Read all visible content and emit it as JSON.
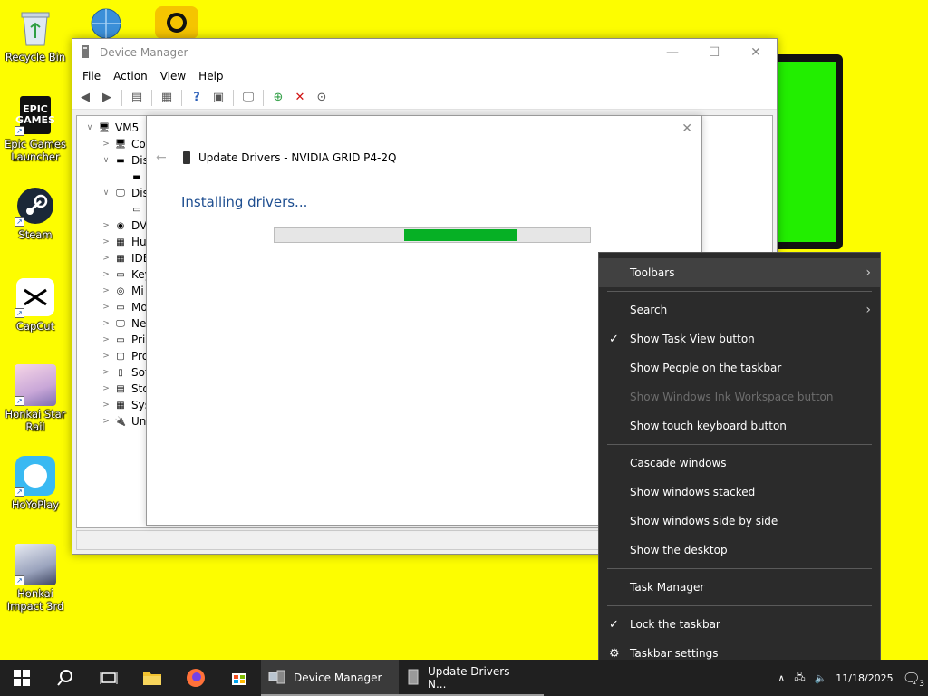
{
  "desktop": {
    "icons": [
      {
        "label": "Recycle Bin"
      },
      {
        "label": "Epic Games Launcher",
        "logo_text": "EPIC GAMES"
      },
      {
        "label": "Steam"
      },
      {
        "label": "CapCut"
      },
      {
        "label": "Honkai Star Rail"
      },
      {
        "label": "HoYoPlay"
      },
      {
        "label": "Honkai Impact 3rd"
      }
    ]
  },
  "device_manager": {
    "title": "Device Manager",
    "menu": [
      "File",
      "Action",
      "View",
      "Help"
    ],
    "tree": [
      {
        "label": "VM5",
        "arrow": "∨"
      },
      {
        "label": "Co",
        "arrow": ">"
      },
      {
        "label": "Dis",
        "arrow": "∨"
      },
      {
        "label": "",
        "arrow": ""
      },
      {
        "label": "Dis",
        "arrow": "∨"
      },
      {
        "label": "",
        "arrow": ""
      },
      {
        "label": "DV",
        "arrow": ">"
      },
      {
        "label": "Hu",
        "arrow": ">"
      },
      {
        "label": "IDE",
        "arrow": ">"
      },
      {
        "label": "Key",
        "arrow": ">"
      },
      {
        "label": "Mi",
        "arrow": ">"
      },
      {
        "label": "Mo",
        "arrow": ">"
      },
      {
        "label": "Ne",
        "arrow": ">"
      },
      {
        "label": "Pri",
        "arrow": ">"
      },
      {
        "label": "Pro",
        "arrow": ">"
      },
      {
        "label": "Sof",
        "arrow": ">"
      },
      {
        "label": "Sto",
        "arrow": ">"
      },
      {
        "label": "Sys",
        "arrow": ">"
      },
      {
        "label": "Un",
        "arrow": ">"
      }
    ]
  },
  "update_dialog": {
    "title": "Update Drivers - NVIDIA GRID P4-2Q",
    "status": "Installing drivers...",
    "progress": {
      "start": 0.41,
      "end": 0.77
    }
  },
  "context_menu": {
    "items": [
      {
        "label": "Toolbars",
        "submenu": true,
        "hover": true
      },
      {
        "sep": true
      },
      {
        "label": "Search",
        "submenu": true
      },
      {
        "label": "Show Task View button",
        "checked": true
      },
      {
        "label": "Show People on the taskbar"
      },
      {
        "label": "Show Windows Ink Workspace button",
        "disabled": true
      },
      {
        "label": "Show touch keyboard button"
      },
      {
        "sep": true
      },
      {
        "label": "Cascade windows"
      },
      {
        "label": "Show windows stacked"
      },
      {
        "label": "Show windows side by side"
      },
      {
        "label": "Show the desktop"
      },
      {
        "sep": true
      },
      {
        "label": "Task Manager"
      },
      {
        "sep": true
      },
      {
        "label": "Lock the taskbar",
        "checked": true
      },
      {
        "label": "Taskbar settings",
        "gear": true
      }
    ]
  },
  "taskbar": {
    "apps": [
      {
        "label": "Device Manager"
      },
      {
        "label": "Update Drivers - N..."
      }
    ],
    "date": "11/18/2025",
    "notification_count": "3"
  }
}
